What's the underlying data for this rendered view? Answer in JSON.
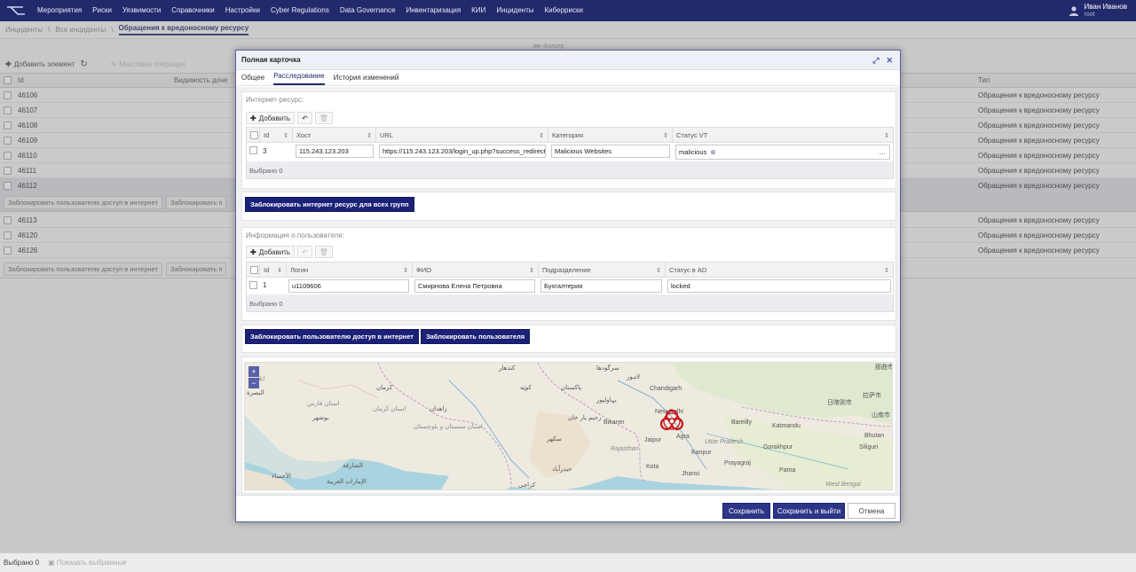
{
  "nav": {
    "items": [
      "Мероприятия",
      "Риски",
      "Уязвимости",
      "Справочники",
      "Настройки",
      "Cyber Regulations",
      "Data Governance",
      "Инвентаризация",
      "КИИ",
      "Инциденты",
      "Киберриски"
    ],
    "user_name": "Иван Иванов",
    "user_role": "root"
  },
  "breadcrumb": [
    "Инциденты",
    "Все инциденты",
    "Обращения к вредоносному ресурсу"
  ],
  "filter_label": "Фильтр",
  "toolbar": {
    "add_label": "Добавить элемент",
    "mass_label": "Массовая операция"
  },
  "bg_table": {
    "col_id": "Id",
    "col_visibility": "Видимость доче",
    "col_type": "Тип",
    "rows_top": [
      {
        "id": "46106",
        "type": "Обращения к вредоносному ресурсу"
      },
      {
        "id": "46107",
        "type": "Обращения к вредоносному ресурсу"
      },
      {
        "id": "46108",
        "type": "Обращения к вредоносному ресурсу"
      },
      {
        "id": "46109",
        "type": "Обращения к вредоносному ресурсу"
      },
      {
        "id": "46110",
        "type": "Обращения к вредоносному ресурсу"
      },
      {
        "id": "46111",
        "type": "Обращения к вредоносному ресурсу"
      },
      {
        "id": "46112",
        "type": "Обращения к вредоносному ресурсу"
      }
    ],
    "rows_bottom": [
      {
        "id": "46113",
        "type": "Обращения к вредоносному ресурсу"
      },
      {
        "id": "46120",
        "type": "Обращения к вредоносному ресурсу"
      },
      {
        "id": "46126",
        "type": "Обращения к вредоносному ресурсу"
      }
    ],
    "row_action_1": "Заблокировать пользователю доступ в интернет",
    "row_action_2": "Заблокировать п"
  },
  "footer": {
    "selected": "Выбрано 0",
    "show_selected": "Показать выбранные"
  },
  "modal": {
    "title": "Полная карточка",
    "tabs": [
      "Общее",
      "Расследование",
      "История изменений"
    ],
    "resource": {
      "section_title": "Интернет-ресурс:",
      "add_label": "Добавить",
      "headers": {
        "id": "Id",
        "host": "Хост",
        "url": "URL",
        "category": "Категория",
        "status": "Статус VT"
      },
      "row": {
        "id": "3",
        "host": "115.243.123.203",
        "url": "https://115.243.123.203/login_up.php?success_redirect_url=",
        "category": "Malicious Websites",
        "status": "malicious"
      },
      "selected": "Выбрано 0",
      "block_button": "Заблокировать интернет ресурс для всех групп"
    },
    "user": {
      "section_title": "Информация о пользователе:",
      "add_label": "Добавить",
      "headers": {
        "id": "Id",
        "login": "Логин",
        "fio": "ФИО",
        "dept": "Подразделение",
        "status": "Статус в AD"
      },
      "row": {
        "id": "1",
        "login": "u1109606",
        "fio": "Смирнова Елена Петровна",
        "dept": "Бухгалтерия",
        "status": "locked"
      },
      "selected": "Выбрано 0",
      "block_internet_button": "Заблокировать пользователю доступ в интернет",
      "block_user_button": "Заблокировать пользователя"
    },
    "map": {
      "labels": {
        "chandigarh": "Chandigarh",
        "new_delhi": "New Delhi",
        "bikaner": "Bikaner",
        "jaipur": "Jaipur",
        "agra": "Agra",
        "bareilly": "Bareilly",
        "kathmandu": "Katmandu",
        "uttar_pradesh": "Uttar Pradesh",
        "kota": "Kota",
        "kanpur": "Kanpur",
        "prayagraj": "Prayagraj",
        "gorakhpur": "Gorakhpur",
        "siliguri": "Siliguri",
        "bhutan": "Bhutan",
        "patna": "Patna",
        "jhansi": "Jhansi",
        "rajasthan": "Rajasthan",
        "west_bengal": "West Bengal",
        "pakistan": "پاکستان",
        "kandahar": "کندهار",
        "quetta": "کوټه",
        "zahedan": "زاهدان",
        "kerman": "کرمان",
        "bushehr": "بوشهر",
        "karachi": "کراچی",
        "sukkur": "سکھر",
        "hyderabad": "حیدرآباد",
        "rahim_yar_khan": "رحیم یار خان",
        "bahawalpur": "بہاولپور",
        "lahore": "لاہور",
        "sargodha": "سرگودھا",
        "hyd_ind": "حیدرآباد",
        "uae": "الإمارات العربية",
        "ahsa": "الأحساء",
        "sharjah": "الشارقة",
        "basra": "البصرة",
        "nepal_chn": "日喀则市",
        "lhasa": "拉萨市",
        "shannan": "山南市",
        "nagqu": "那曲市",
        "kerman_prov": "استان کرمان",
        "fars_prov": "استان فارس",
        "sistan_prov": "استان سیستان و بلوچستان",
        "ilam": "ایلام"
      },
      "zoom_in": "+",
      "zoom_out": "−"
    },
    "save_button": "Сохранить",
    "save_exit_button": "Сохранить и выйти",
    "cancel_button": "Отмена"
  }
}
